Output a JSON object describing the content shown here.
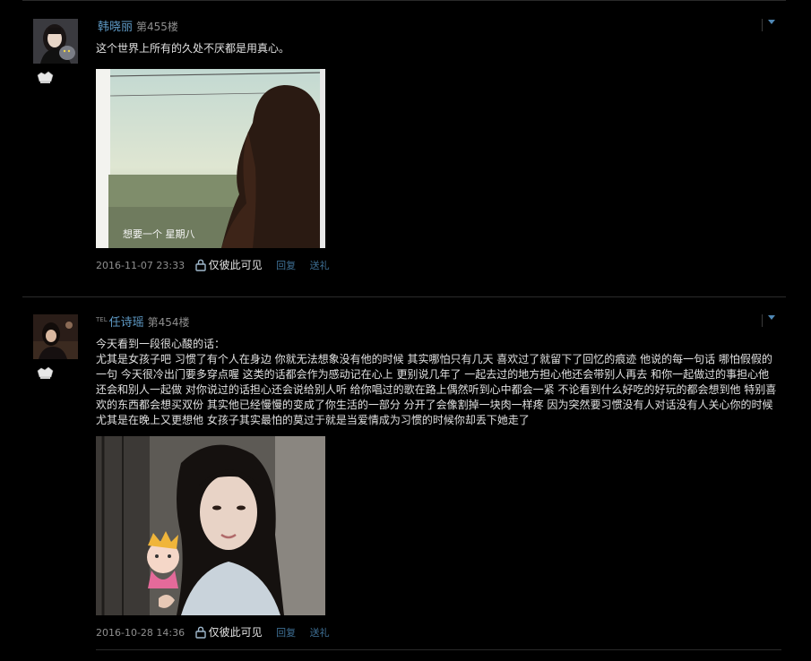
{
  "posts": [
    {
      "username": "韩晓丽",
      "tel_tag": "",
      "floor": "第455楼",
      "content": [
        "这个世界上所有的久处不厌都是用真心。"
      ],
      "image_caption": "想要一个 星期八",
      "timestamp": "2016-11-07 23:33",
      "privacy_label": "仅彼此可见",
      "reply_label": "回复",
      "gift_label": "送礼"
    },
    {
      "username": "任诗瑶",
      "tel_tag": "TEL",
      "floor": "第454楼",
      "content": [
        "今天看到一段很心酸的话：",
        "尤其是女孩子吧 习惯了有个人在身边 你就无法想象没有他的时候 其实哪怕只有几天 喜欢过了就留下了回忆的痕迹 他说的每一句话 哪怕假假的一句 今天很冷出门要多穿点喔 这类的话都会作为感动记在心上 更别说几年了 一起去过的地方担心他还会带别人再去 和你一起做过的事担心他还会和别人一起做 对你说过的话担心还会说给别人听 给你唱过的歌在路上偶然听到心中都会一紧 不论看到什么好吃的好玩的都会想到他 特别喜欢的东西都会想买双份 其实他已经慢慢的变成了你生活的一部分 分开了会像割掉一块肉一样疼 因为突然要习惯没有人对话没有人关心你的时候 尤其是在晚上又更想他 女孩子其实最怕的莫过于就是当爱情成为习惯的时候你却丢下她走了"
      ],
      "image_caption": "",
      "timestamp": "2016-10-28 14:36",
      "privacy_label": "仅彼此可见",
      "reply_label": "回复",
      "gift_label": "送礼"
    }
  ],
  "icons": {
    "menu": "chevron-down-icon",
    "lock": "lock-icon",
    "badge": "member-badge-icon"
  },
  "colors": {
    "background": "#000000",
    "username": "#5f9bc7",
    "action_link": "#3e6f94",
    "meta_text": "#8f8f8f"
  }
}
